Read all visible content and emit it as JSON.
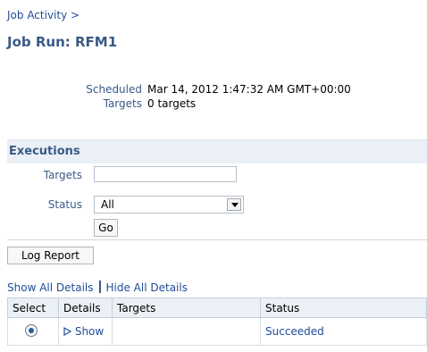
{
  "breadcrumb": {
    "text": "Job Activity  >"
  },
  "page": {
    "title": "Job Run: RFM1"
  },
  "summary": {
    "scheduled_label": "Scheduled",
    "scheduled_value": "Mar 14, 2012 1:47:32 AM GMT+00:00",
    "targets_label": "Targets",
    "targets_value": "0 targets"
  },
  "executions": {
    "title": "Executions",
    "filters": {
      "targets_label": "Targets",
      "targets_value": "",
      "status_label": "Status",
      "status_value": "All"
    },
    "go_label": "Go",
    "log_report_label": "Log Report",
    "show_all_details": "Show All Details",
    "hide_all_details": "Hide All Details",
    "table": {
      "columns": [
        "Select",
        "Details",
        "Targets",
        "Status"
      ],
      "rows": [
        {
          "selected": true,
          "details": "Show",
          "targets": "",
          "status": "Succeeded"
        }
      ]
    }
  },
  "colors": {
    "link": "#1f4b99",
    "heading": "#3a5a86",
    "section_bg": "#eaf0f6"
  }
}
